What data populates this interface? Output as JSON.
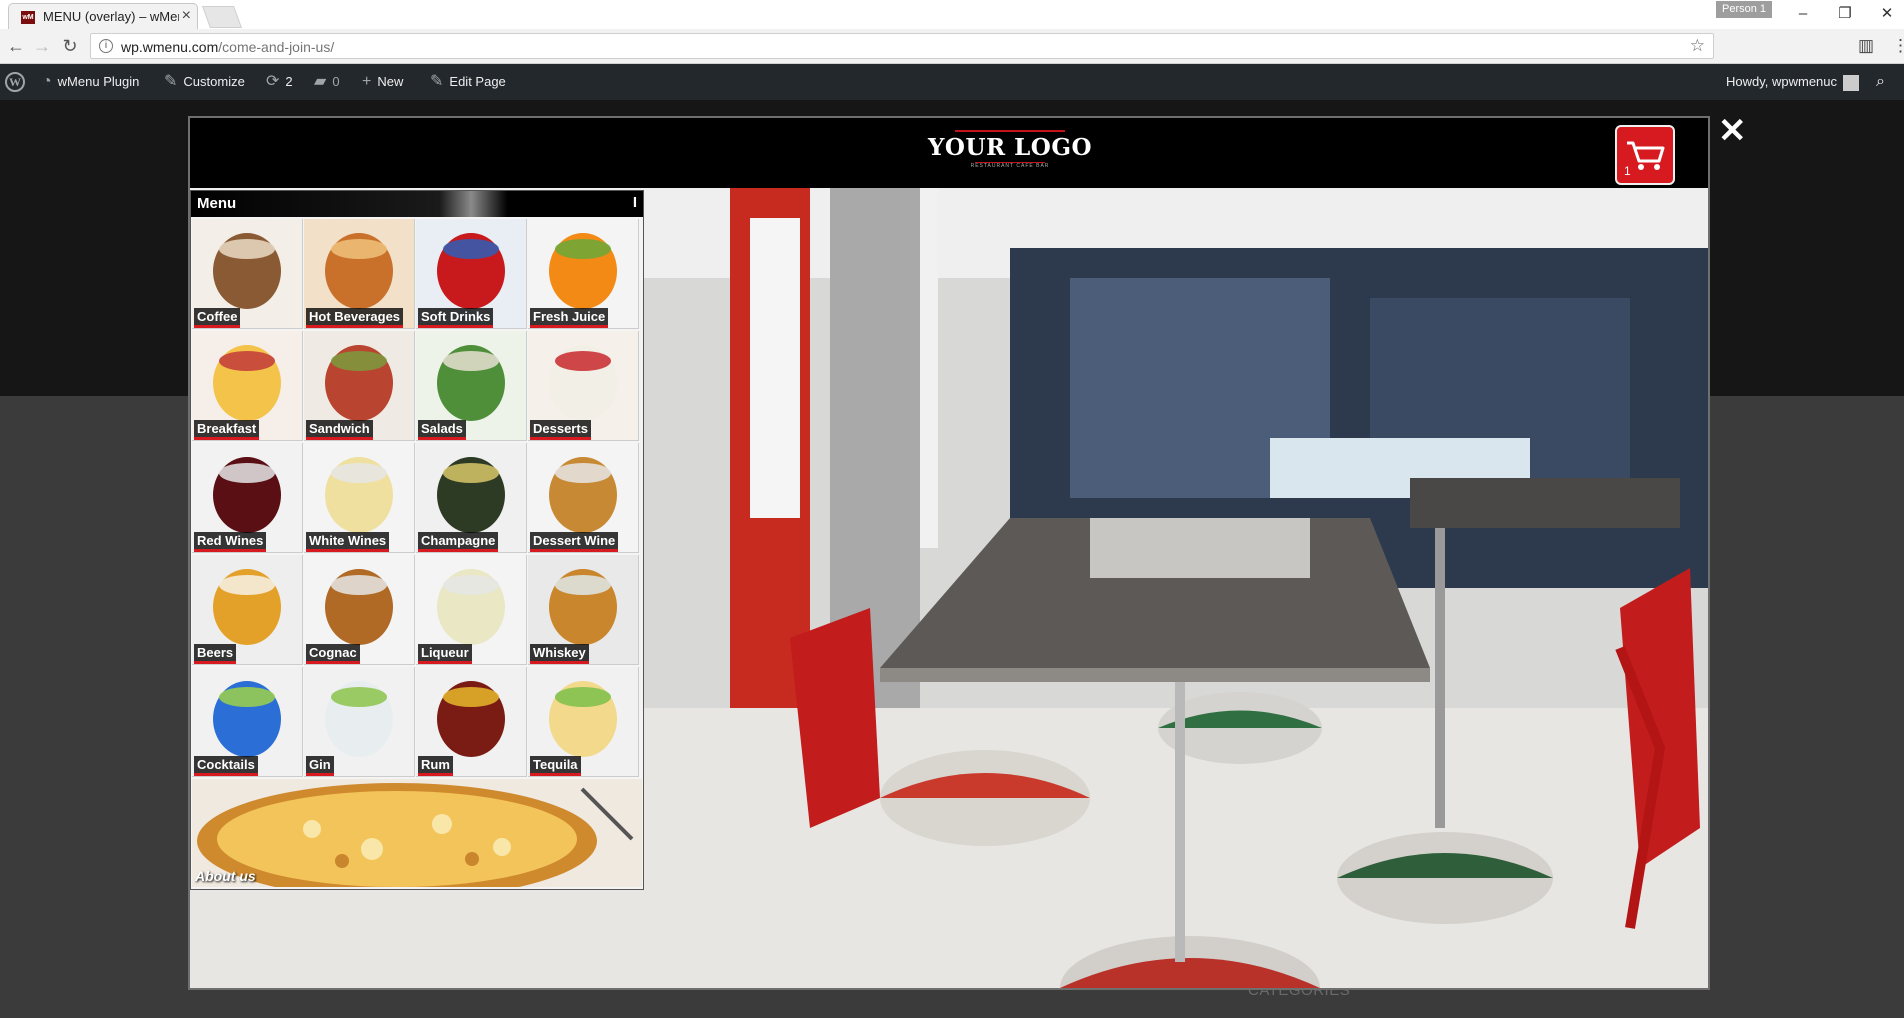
{
  "browser": {
    "tab_title": "MENU (overlay) – wMenu",
    "tab_favicon": "wM",
    "profile": "Person 1",
    "url_host": "wp.wmenu.com",
    "url_path": "/come-and-join-us/",
    "window_controls": [
      "minimize-icon",
      "restore-icon",
      "close-icon"
    ]
  },
  "adminbar": {
    "site_name": "wMenu Plugin",
    "customize": "Customize",
    "updates_count": "2",
    "comments_count": "0",
    "new_label": "New",
    "edit_label": "Edit Page",
    "howdy": "Howdy, wpwmenuc"
  },
  "page": {
    "categories_label": "CATEGORIES"
  },
  "modal": {
    "logo_text": "YOUR LOGO",
    "logo_subtitle": "RESTAURANT CAFE BAR",
    "cart_count": "1",
    "close_symbol": "✕"
  },
  "menu": {
    "title": "Menu",
    "toggle": "I",
    "items": [
      {
        "label": "Coffee"
      },
      {
        "label": "Hot Beverages"
      },
      {
        "label": "Soft Drinks"
      },
      {
        "label": "Fresh Juice"
      },
      {
        "label": "Breakfast"
      },
      {
        "label": "Sandwich"
      },
      {
        "label": "Salads"
      },
      {
        "label": "Desserts"
      },
      {
        "label": "Red Wines"
      },
      {
        "label": "White Wines"
      },
      {
        "label": "Champagne"
      },
      {
        "label": "Dessert Wine"
      },
      {
        "label": "Beers"
      },
      {
        "label": "Cognac"
      },
      {
        "label": "Liqueur"
      },
      {
        "label": "Whiskey"
      },
      {
        "label": "Cocktails"
      },
      {
        "label": "Gin"
      },
      {
        "label": "Rum"
      },
      {
        "label": "Tequila"
      }
    ],
    "about": "About us"
  },
  "colors": {
    "accent_red": "#d71920",
    "admin_bar": "#23282d"
  }
}
